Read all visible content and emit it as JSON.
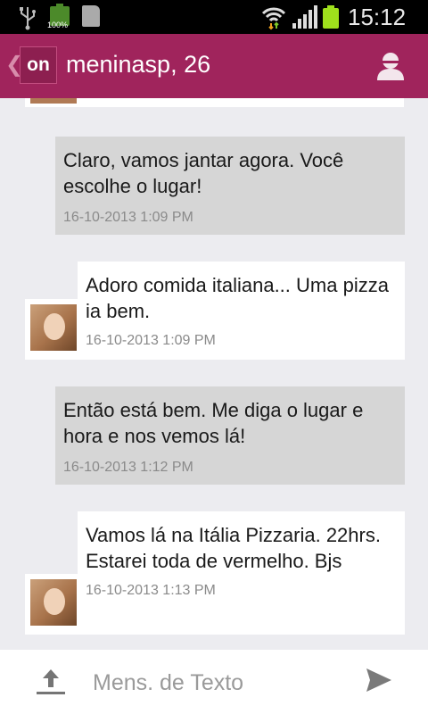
{
  "status_bar": {
    "battery_small_label": "100%",
    "clock": "15:12",
    "icons": [
      "usb-icon",
      "battery-icon",
      "sim-card-icon",
      "wifi-icon",
      "signal-icon",
      "battery-icon"
    ]
  },
  "header": {
    "logo_text": "on",
    "title": "meninasp, 26",
    "icons": [
      "back-chevron-icon",
      "profile-icon"
    ],
    "color": "#a0245c"
  },
  "messages": [
    {
      "direction": "sent",
      "text": "Claro, vamos jantar agora. Você escolhe o lugar!",
      "timestamp": "16-10-2013 1:09 PM"
    },
    {
      "direction": "received",
      "text": "Adoro comida italiana... Uma pizza ia bem.",
      "timestamp": "16-10-2013 1:09 PM"
    },
    {
      "direction": "sent",
      "text": "Então está bem. Me diga o lugar e hora e nos vemos lá!",
      "timestamp": "16-10-2013 1:12 PM"
    },
    {
      "direction": "received",
      "text": "Vamos lá na Itália Pizzaria. 22hrs. Estarei toda de vermelho. Bjs",
      "timestamp": "16-10-2013 1:13 PM"
    }
  ],
  "compose": {
    "placeholder": "Mens. de Texto",
    "value": "",
    "icons": [
      "upload-icon",
      "send-icon"
    ]
  },
  "colors": {
    "sent_bubble": "#d6d6d6",
    "received_bubble": "#ffffff",
    "background": "#ececf0"
  }
}
